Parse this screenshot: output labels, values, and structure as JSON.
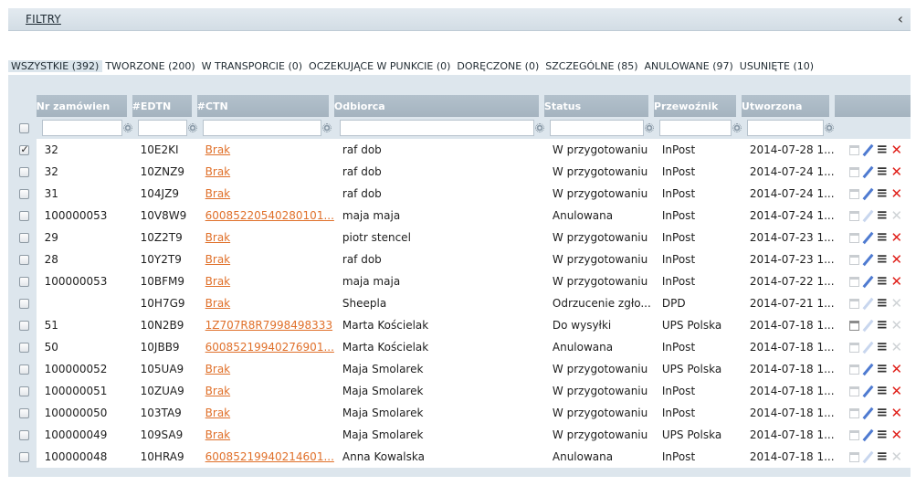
{
  "filter_bar": {
    "label": "FILTRY"
  },
  "tabs": [
    {
      "label": "WSZYSTKIE (392)",
      "active": true
    },
    {
      "label": "TWORZONE (200)"
    },
    {
      "label": "W TRANSPORCIE (0)"
    },
    {
      "label": "OCZEKUJĄCE W PUNKCIE (0)"
    },
    {
      "label": "DORĘCZONE (0)"
    },
    {
      "label": "SZCZEGÓLNE (85)"
    },
    {
      "label": "ANULOWANE (97)"
    },
    {
      "label": "USUNIĘTE (10)"
    }
  ],
  "columns": [
    "Nr zamówien",
    "#EDTN",
    "#CTN",
    "Odbiorca",
    "Status",
    "Przewoźnik",
    "Utworzona"
  ],
  "rows": [
    {
      "checked": true,
      "order": "32",
      "edtn": "10E2KI",
      "ctn": "Brak",
      "recipient": "raf dob",
      "status": "W przygotowaniu",
      "carrier": "InPost",
      "created": "2014-07-28 1...",
      "active": true
    },
    {
      "checked": false,
      "order": "32",
      "edtn": "10ZNZ9",
      "ctn": "Brak",
      "recipient": "raf dob",
      "status": "W przygotowaniu",
      "carrier": "InPost",
      "created": "2014-07-24 1...",
      "active": true
    },
    {
      "checked": false,
      "order": "31",
      "edtn": "104JZ9",
      "ctn": "Brak",
      "recipient": "raf dob",
      "status": "W przygotowaniu",
      "carrier": "InPost",
      "created": "2014-07-24 1...",
      "active": true
    },
    {
      "checked": false,
      "order": "100000053",
      "edtn": "10V8W9",
      "ctn": "60085220540280101...",
      "recipient": "maja maja",
      "status": "Anulowana",
      "carrier": "InPost",
      "created": "2014-07-24 1...",
      "active": false
    },
    {
      "checked": false,
      "order": "29",
      "edtn": "10Z2T9",
      "ctn": "Brak",
      "recipient": "piotr stencel",
      "status": "W przygotowaniu",
      "carrier": "InPost",
      "created": "2014-07-23 1...",
      "active": true
    },
    {
      "checked": false,
      "order": "28",
      "edtn": "10Y2T9",
      "ctn": "Brak",
      "recipient": "raf dob",
      "status": "W przygotowaniu",
      "carrier": "InPost",
      "created": "2014-07-23 1...",
      "active": true
    },
    {
      "checked": false,
      "order": "100000053",
      "edtn": "10BFM9",
      "ctn": "Brak",
      "recipient": "maja maja",
      "status": "W przygotowaniu",
      "carrier": "InPost",
      "created": "2014-07-22 1...",
      "active": true
    },
    {
      "checked": false,
      "order": "",
      "edtn": "10H7G9",
      "ctn": "Brak",
      "recipient": "Sheepla",
      "status": "Odrzucenie zgło...",
      "carrier": "DPD",
      "created": "2014-07-21 1...",
      "active": false
    },
    {
      "checked": false,
      "order": "51",
      "edtn": "10N2B9",
      "ctn": "1Z707R8R7998498333",
      "recipient": "Marta Kościelak",
      "status": "Do wysyłki",
      "carrier": "UPS Polska",
      "created": "2014-07-18 1...",
      "active": false,
      "cal_active": true
    },
    {
      "checked": false,
      "order": "50",
      "edtn": "10JBB9",
      "ctn": "60085219940276901...",
      "recipient": "Marta Kościelak",
      "status": "Anulowana",
      "carrier": "InPost",
      "created": "2014-07-18 1...",
      "active": false
    },
    {
      "checked": false,
      "order": "100000052",
      "edtn": "105UA9",
      "ctn": "Brak",
      "recipient": "Maja Smolarek",
      "status": "W przygotowaniu",
      "carrier": "UPS Polska",
      "created": "2014-07-18 1...",
      "active": true
    },
    {
      "checked": false,
      "order": "100000051",
      "edtn": "10ZUA9",
      "ctn": "Brak",
      "recipient": "Maja Smolarek",
      "status": "W przygotowaniu",
      "carrier": "InPost",
      "created": "2014-07-18 1...",
      "active": true
    },
    {
      "checked": false,
      "order": "100000050",
      "edtn": "103TA9",
      "ctn": "Brak",
      "recipient": "Maja Smolarek",
      "status": "W przygotowaniu",
      "carrier": "InPost",
      "created": "2014-07-18 1...",
      "active": true
    },
    {
      "checked": false,
      "order": "100000049",
      "edtn": "109SA9",
      "ctn": "Brak",
      "recipient": "Maja Smolarek",
      "status": "W przygotowaniu",
      "carrier": "UPS Polska",
      "created": "2014-07-18 1...",
      "active": true
    },
    {
      "checked": false,
      "order": "100000048",
      "edtn": "10HRA9",
      "ctn": "60085219940214601...",
      "recipient": "Anna Kowalska",
      "status": "Anulowana",
      "carrier": "InPost",
      "created": "2014-07-18 1...",
      "active": false
    }
  ],
  "icons": {
    "collapse": "chevron-left-icon",
    "filter_gear": "gear-icon",
    "row_actions": [
      "calendar-icon",
      "pencil-icon",
      "list-icon",
      "delete-icon"
    ]
  },
  "colors": {
    "link": "#e0702a",
    "delete": "#e0211b",
    "header": "#a4b3bf",
    "panel": "#dde6ed"
  }
}
